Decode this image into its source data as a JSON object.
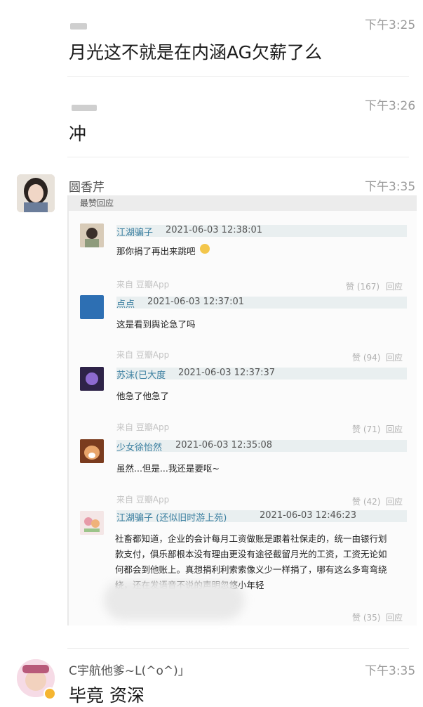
{
  "messages": [
    {
      "author": "",
      "time": "下午3:25",
      "text": "月光这不就是在内涵AG欠薪了么"
    },
    {
      "author": "",
      "time": "下午3:26",
      "text": "冲"
    },
    {
      "author": "圆香芹",
      "time": "下午3:35"
    },
    {
      "author": "C宇航他爹~L(^o^)」",
      "time": "下午3:35",
      "text": "毕竟 资深"
    }
  ],
  "card": {
    "header": "最赞回应",
    "comments": [
      {
        "name": "江湖骗子",
        "date": "2021-06-03 12:38:01",
        "text": "那你捐了再出来跳吧",
        "from": "来自 豆瓣App",
        "likes": "赞 (167)",
        "reply": "回应"
      },
      {
        "name": "点点",
        "date": "2021-06-03 12:37:01",
        "text": "这是看到舆论急了吗",
        "from": "来自 豆瓣App",
        "likes": "赞 (94)",
        "reply": "回应"
      },
      {
        "name": "苏沫(已大度",
        "date": "2021-06-03 12:37:37",
        "text": "他急了他急了",
        "from": "来自 豆瓣App",
        "likes": "赞 (71)",
        "reply": "回应"
      },
      {
        "name": "少女徐怡然",
        "date": "2021-06-03 12:35:08",
        "text": "虽然...但是...我还是要呕~",
        "from": "来自 豆瓣App",
        "likes": "赞 (42)",
        "reply": "回应"
      },
      {
        "name": "江湖骗子 (还似旧时游上苑)",
        "date": "2021-06-03 12:46:23",
        "lines": [
          "社畜都知道，企业的会计每月工资做账是跟着社保走的，统一由银行划",
          "款支付，俱乐部根本没有理由更没有途径截留月光的工资，工资无论如",
          "何都会到他账上。真想捐利利索索像义少一样捐了，哪有这么多弯弯绕",
          "绕，还在发语音不说的声明忽悠小年轻"
        ],
        "likes": "赞 (35)",
        "reply": "回应"
      }
    ]
  },
  "colors": {
    "time": "#9a9a9a",
    "name_link": "#3b7fa0",
    "divider": "#ececec"
  }
}
